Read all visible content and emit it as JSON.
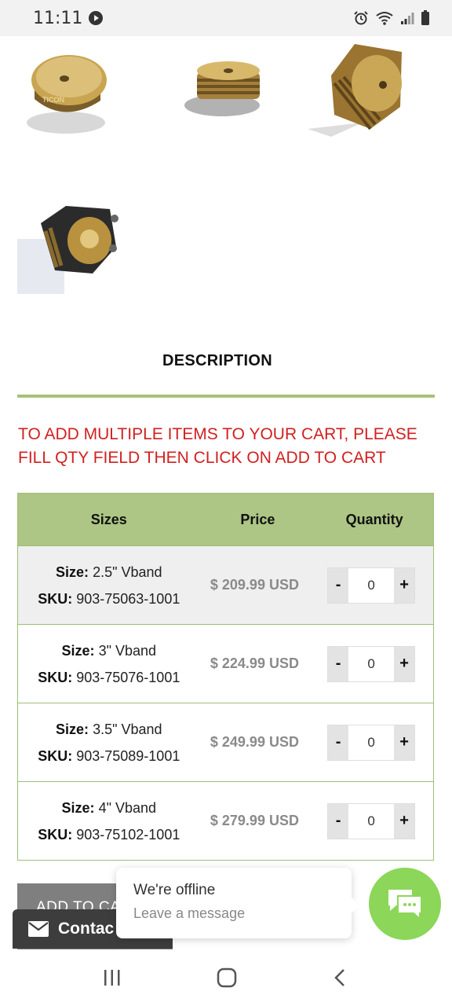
{
  "status_bar": {
    "time": "11:11"
  },
  "description_tab": {
    "label": "DESCRIPTION"
  },
  "notice": "TO ADD MULTIPLE ITEMS TO YOUR CART, PLEASE FILL QTY FIELD THEN CLICK ON ADD TO CART",
  "table": {
    "headers": {
      "sizes": "Sizes",
      "price": "Price",
      "quantity": "Quantity"
    },
    "size_label": "Size:",
    "sku_label": "SKU:",
    "rows": [
      {
        "size": "2.5\" Vband",
        "sku": "903-75063-1001",
        "price": "$ 209.99 USD",
        "qty": "0",
        "minus": "-",
        "plus": "+"
      },
      {
        "size": "3\" Vband",
        "sku": "903-75076-1001",
        "price": "$ 224.99 USD",
        "qty": "0",
        "minus": "-",
        "plus": "+"
      },
      {
        "size": "3.5\" Vband",
        "sku": "903-75089-1001",
        "price": "$ 249.99 USD",
        "qty": "0",
        "minus": "-",
        "plus": "+"
      },
      {
        "size": "4\" Vband",
        "sku": "903-75102-1001",
        "price": "$ 279.99 USD",
        "qty": "0",
        "minus": "-",
        "plus": "+"
      }
    ]
  },
  "add_to_cart": {
    "label": "ADD TO CA"
  },
  "contact": {
    "label": "Contac",
    "icon": "envelope-icon"
  },
  "chat": {
    "title": "We're offline",
    "subtitle": "Leave a message",
    "launcher_icon": "chat-bubbles-icon",
    "accent": "#8cd659"
  },
  "nav": {
    "icons": [
      "recent-apps-icon",
      "home-icon",
      "back-icon"
    ]
  },
  "colors": {
    "table_header": "#adc585",
    "rule": "#a7c17a",
    "notice": "#d22020"
  }
}
